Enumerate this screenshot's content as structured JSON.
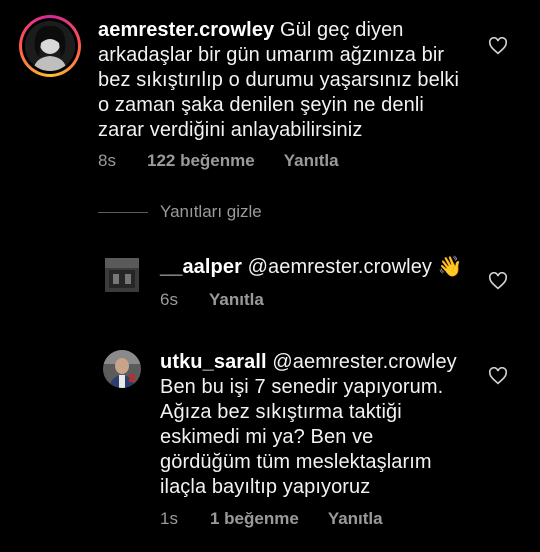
{
  "comments": [
    {
      "username": "aemrester.crowley",
      "text": "Gül geç diyen arkadaşlar bir gün umarım ağzınıza bir bez sıkıştırılıp o durumu yaşarsınız belki o zaman şaka denilen şeyin ne denli zarar verdiğini anlayabilirsiniz",
      "lines": [
        "Gül geç diyen",
        "arkadaşlar bir gün umarım ağzınıza bir",
        "bez sıkıştırılıp o durumu yaşarsınız belki",
        "o zaman şaka denilen şeyin ne denli",
        "zarar verdiğini anlayabilirsiniz"
      ],
      "time": "8s",
      "likes": "122 beğenme",
      "reply": "Yanıtla"
    }
  ],
  "hide_replies": "Yanıtları gizle",
  "replies": [
    {
      "username": "__aalper",
      "mention": "@aemrester.crowley",
      "emoji": "👋",
      "time": "6s",
      "reply": "Yanıtla"
    },
    {
      "username": "utku_sarall",
      "mention": "@aemrester.crowley",
      "lines": [
        "Ben bu işi 7 senedir yapıyorum.",
        "Ağıza bez sıkıştırma taktiği",
        "eskimedi mi ya? Ben ve",
        "gördüğüm tüm meslektaşlarım",
        "ilaçla bayıltıp yapıyoruz"
      ],
      "time": "1s",
      "likes": "1 beğenme",
      "reply": "Yanıtla"
    }
  ],
  "icons": {
    "heart": "heart-outline-icon"
  },
  "colors": {
    "background": "#000000",
    "text": "#f2f2f2",
    "meta": "#9a9a9a",
    "story_ring": "#d6249f"
  }
}
